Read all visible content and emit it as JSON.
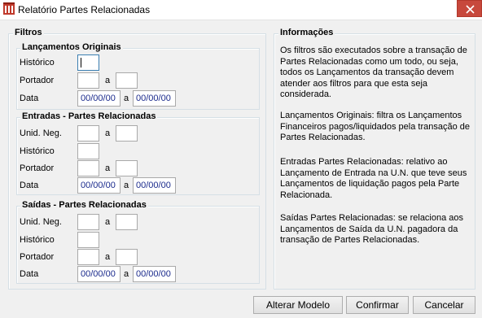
{
  "window": {
    "title": "Relatório Partes Relacionadas",
    "close_glyph": "✕"
  },
  "filtros": {
    "title": "Filtros",
    "lancamentos": {
      "title": "Lançamentos Originais",
      "historico_label": "Histórico",
      "portador_label": "Portador",
      "a_label": "a",
      "data_label": "Data",
      "data_from": "00/00/00",
      "data_to": "00/00/00"
    },
    "entradas": {
      "title": "Entradas - Partes Relacionadas",
      "unid_label": "Unid. Neg.",
      "historico_label": "Histórico",
      "portador_label": "Portador",
      "a_label": "a",
      "data_label": "Data",
      "data_from": "00/00/00",
      "data_to": "00/00/00"
    },
    "saidas": {
      "title": "Saídas - Partes Relacionadas",
      "unid_label": "Unid. Neg.",
      "historico_label": "Histórico",
      "portador_label": "Portador",
      "a_label": "a",
      "data_label": "Data",
      "data_from": "00/00/00",
      "data_to": "00/00/00"
    }
  },
  "informacoes": {
    "title": "Informações",
    "paragraphs": [
      "Os filtros são executados sobre a transação de Partes Relacionadas como um todo, ou seja, todos os Lançamentos da transação devem atender aos filtros para que esta seja considerada.",
      "Lançamentos Originais: filtra os Lançamentos Financeiros pagos/liquidados pela transação de Partes Relacionadas.",
      "Entradas Partes Relacionadas: relativo ao Lançamento de Entrada na U.N. que teve seus Lançamentos de liquidação pagos pela Parte Relacionada.",
      "Saídas Partes Relacionadas: se relaciona aos Lançamentos de Saída da U.N. pagadora da transação de Partes Relacionadas."
    ]
  },
  "buttons": {
    "alterar_modelo": "Alterar Modelo",
    "confirmar": "Confirmar",
    "cancelar": "Cancelar"
  },
  "colors": {
    "close_button": "#c7483c",
    "date_text": "#1a2a8c",
    "icon": "#c0392b"
  },
  "icons": {
    "app": "report-app-icon",
    "close": "close-icon"
  }
}
